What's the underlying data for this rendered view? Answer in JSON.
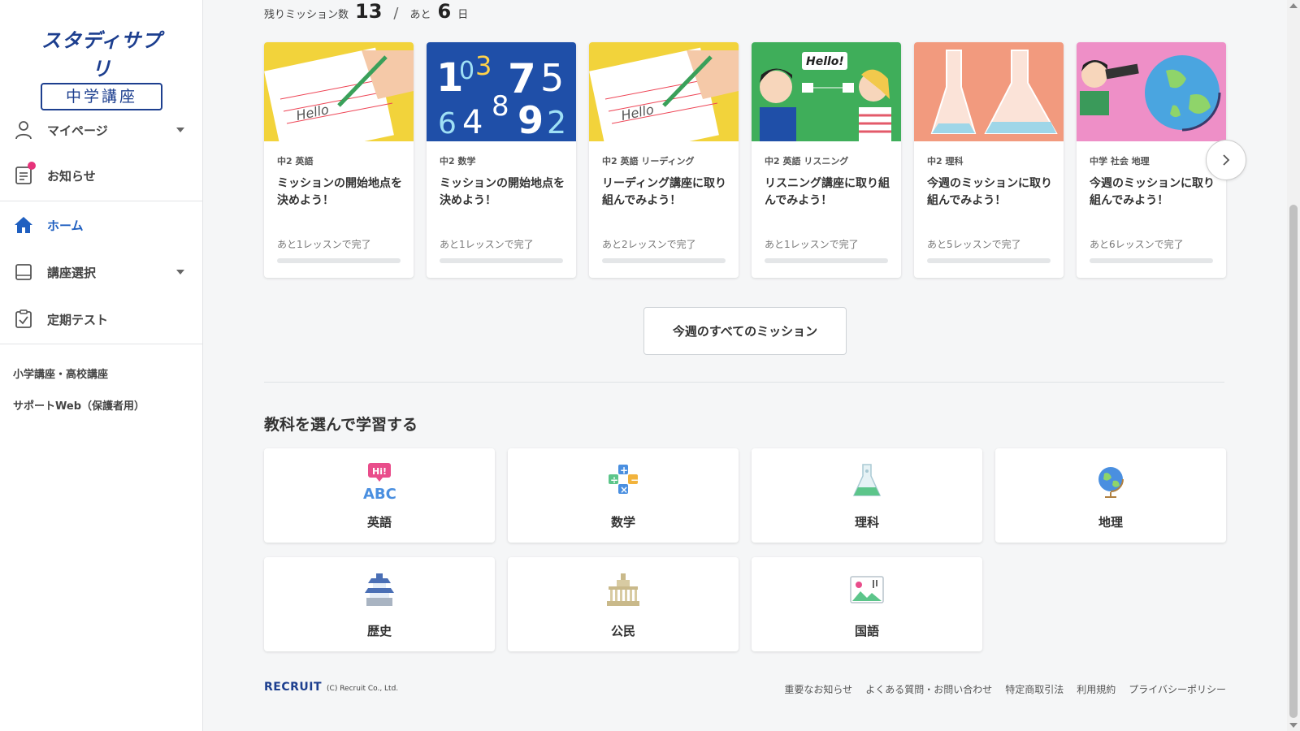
{
  "brand": {
    "logo_main": "スタディサプリ",
    "logo_sub": "中学講座"
  },
  "sidebar": {
    "items": [
      {
        "label": "マイページ",
        "icon": "user-icon"
      },
      {
        "label": "お知らせ",
        "icon": "notice-icon"
      },
      {
        "label": "ホーム",
        "icon": "home-icon"
      },
      {
        "label": "講座選択",
        "icon": "book-icon"
      },
      {
        "label": "定期テスト",
        "icon": "test-icon"
      }
    ],
    "links": [
      "小学講座・高校講座",
      "サポートWeb（保護者用）"
    ]
  },
  "missions": {
    "remaining_label": "残りミッション数",
    "remaining_count": "13",
    "days_prefix": "あと",
    "days_count": "6",
    "days_suffix": "日",
    "cards": [
      {
        "category": "中2 英語",
        "title": "ミッションの開始地点を決めよう！",
        "progress": "あと1レッスンで完了",
        "thumb": "english-writing"
      },
      {
        "category": "中2 数学",
        "title": "ミッションの開始地点を決めよう！",
        "progress": "あと1レッスンで完了",
        "thumb": "math-numbers"
      },
      {
        "category": "中2 英語 リーディング",
        "title": "リーディング講座に取り組んでみよう！",
        "progress": "あと2レッスンで完了",
        "thumb": "english-writing"
      },
      {
        "category": "中2 英語 リスニング",
        "title": "リスニング講座に取り組んでみよう！",
        "progress": "あと1レッスンで完了",
        "thumb": "listening"
      },
      {
        "category": "中2 理科",
        "title": "今週のミッションに取り組んでみよう！",
        "progress": "あと5レッスンで完了",
        "thumb": "flasks"
      },
      {
        "category": "中学 社会 地理",
        "title": "今週のミッションに取り組んでみよう！",
        "progress": "あと6レッスンで完了",
        "thumb": "globe"
      }
    ],
    "all_button": "今週のすべてのミッション"
  },
  "subjects": {
    "title": "教科を選んで学習する",
    "items": [
      {
        "label": "英語",
        "icon": "abc-icon"
      },
      {
        "label": "数学",
        "icon": "math-icon"
      },
      {
        "label": "理科",
        "icon": "flask-icon"
      },
      {
        "label": "地理",
        "icon": "globe-icon"
      },
      {
        "label": "歴史",
        "icon": "castle-icon"
      },
      {
        "label": "公民",
        "icon": "parliament-icon"
      },
      {
        "label": "国語",
        "icon": "book-picture-icon"
      }
    ]
  },
  "footer": {
    "brand": "RECRUIT",
    "copyright": "(C) Recruit Co., Ltd.",
    "links": [
      "重要なお知らせ",
      "よくある質問・お問い合わせ",
      "特定商取引法",
      "利用規約",
      "プライバシーポリシー"
    ]
  },
  "colors": {
    "accent": "#1f5fc0",
    "brand": "#1d3f8f",
    "notification": "#e6337a"
  }
}
